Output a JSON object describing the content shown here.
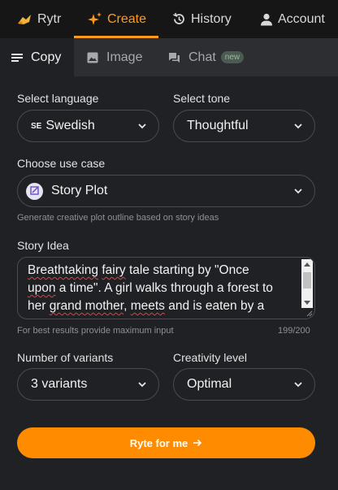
{
  "nav": {
    "brand": "Rytr",
    "create": "Create",
    "history": "History",
    "account": "Account"
  },
  "subtabs": {
    "copy": "Copy",
    "image": "Image",
    "chat": "Chat",
    "chat_badge": "new"
  },
  "form": {
    "language_label": "Select language",
    "language_flag": "SE",
    "language_value": "Swedish",
    "tone_label": "Select tone",
    "tone_value": "Thoughtful",
    "usecase_label": "Choose use case",
    "usecase_value": "Story Plot",
    "usecase_help": "Generate creative plot outline based on story ideas",
    "story_label": "Story Idea",
    "story_line1_a": "Breathtaking",
    "story_line1_b": " ",
    "story_line1_c": "fairy",
    "story_line1_d": " tale starting by \"Once",
    "story_line2_a": "upon",
    "story_line2_b": " a time\". A girl walks through a forest to",
    "story_line3_a": "her ",
    "story_line3_b": "grand mother",
    "story_line3_c": ", ",
    "story_line3_d": "meets",
    "story_line3_e": " and is eaten by a",
    "story_help": "For best results provide maximum input",
    "story_count": "199/200",
    "variants_label": "Number of variants",
    "variants_value": "3 variants",
    "creativity_label": "Creativity level",
    "creativity_value": "Optimal",
    "submit_label": "Ryte for me"
  },
  "colors": {
    "accent": "#ff9a1f",
    "button": "#ff8c00",
    "background": "#202124"
  }
}
